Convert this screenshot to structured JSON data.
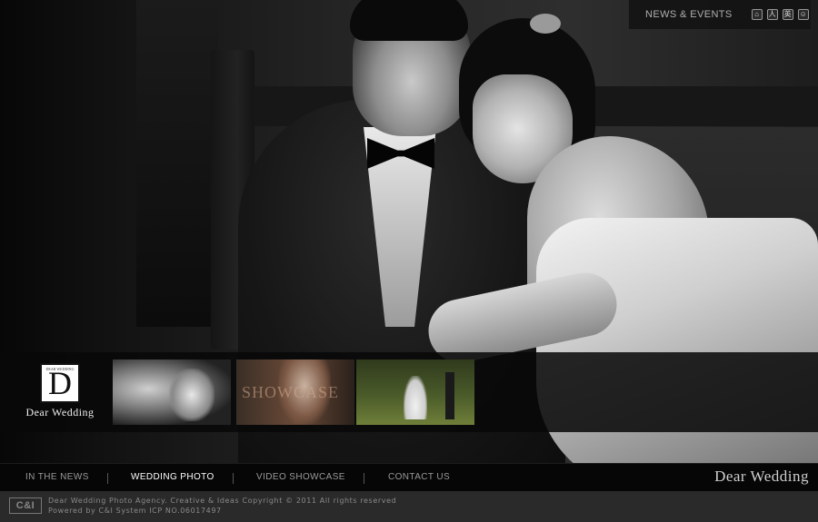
{
  "header": {
    "news_label": "NEWS & EVENTS",
    "icons": [
      {
        "name": "home-icon",
        "glyph": "⌂"
      },
      {
        "name": "person-icon",
        "glyph": "人"
      },
      {
        "name": "language-icon",
        "glyph": "英"
      },
      {
        "name": "contact-icon",
        "glyph": "☺"
      }
    ]
  },
  "brand": {
    "logo_letter": "D",
    "logo_small_text": "DEAR WEDDING",
    "logo_caption": "Dear Wedding",
    "nav_brand": "Dear Wedding"
  },
  "thumbnails": [
    {
      "label": "",
      "alt": "wedding couple portrait"
    },
    {
      "label": "SHOWCASE",
      "alt": "bride showcase"
    },
    {
      "label": "",
      "alt": "couple outdoors"
    }
  ],
  "nav": {
    "items": [
      {
        "label": "IN THE NEWS",
        "active": false
      },
      {
        "label": "WEDDING PHOTO",
        "active": true
      },
      {
        "label": "VIDEO SHOWCASE",
        "active": false
      },
      {
        "label": "CONTACT US",
        "active": false
      }
    ]
  },
  "footer": {
    "logo_text": "C&I",
    "line1": "Dear Wedding Photo Agency. Creative & Ideas Copyright © 2011 All rights reserved",
    "line2": "Powered by C&I System ICP NO.06017497"
  }
}
